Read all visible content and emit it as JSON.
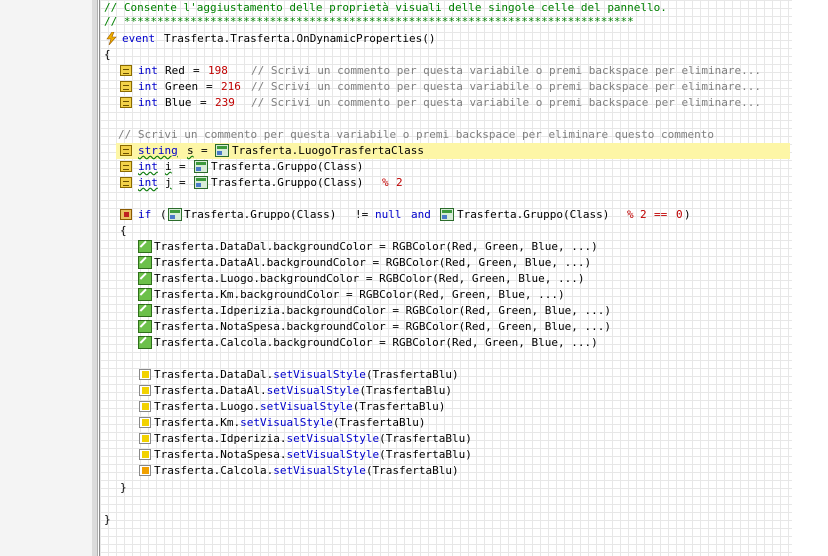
{
  "editor": {
    "comment_header": "// Consente l'aggiustamento delle proprietà visuali delle singole celle del pannello.",
    "comment_stars": "// *****************************************************************************",
    "event_kw": "event",
    "event_name": "Trasferta.Trasferta.OnDynamicProperties()",
    "brace_open": "{",
    "brace_close": "}",
    "vars": [
      {
        "type": "int",
        "name": "Red",
        "value": "198",
        "comment": "// Scrivi un commento per questa variabile o premi backspace per eliminare..."
      },
      {
        "type": "int",
        "name": "Green",
        "value": "216",
        "comment": "// Scrivi un commento per questa variabile o premi backspace per eliminare..."
      },
      {
        "type": "int",
        "name": "Blue",
        "value": "239",
        "comment": "// Scrivi un commento per questa variabile o premi backspace per eliminare..."
      }
    ],
    "comment_block": "// Scrivi un commento per questa variabile o premi backspace per eliminare questo commento",
    "string_decl": {
      "type": "string",
      "name": "s",
      "value": "Trasferta.LuogoTrasfertaClass"
    },
    "int_i": {
      "type": "int",
      "name": "i",
      "value": "Trasferta.Gruppo(Class)"
    },
    "int_j": {
      "type": "int",
      "name": "j",
      "value": "Trasferta.Gruppo(Class)",
      "mod": "%",
      "mod_val": "2"
    },
    "if_stmt": {
      "kw": "if",
      "open": "(",
      "left": "Trasferta.Gruppo(Class)",
      "ne": "!=",
      "null": "null",
      "and": "and",
      "right": "Trasferta.Gruppo(Class)",
      "mod": "%",
      "two": "2",
      "eq": "==",
      "zero": "0",
      "close": ")"
    },
    "assignments": [
      "Trasferta.DataDal.backgroundColor = RGBColor(Red, Green, Blue, ...)",
      "Trasferta.DataAl.backgroundColor = RGBColor(Red, Green, Blue, ...)",
      "Trasferta.Luogo.backgroundColor = RGBColor(Red, Green, Blue, ...)",
      "Trasferta.Km.backgroundColor = RGBColor(Red, Green, Blue, ...)",
      "Trasferta.Idperizia.backgroundColor = RGBColor(Red, Green, Blue, ...)",
      "Trasferta.NotaSpesa.backgroundColor = RGBColor(Red, Green, Blue, ...)",
      "Trasferta.Calcola.backgroundColor = RGBColor(Red, Green, Blue, ...)"
    ],
    "calls": [
      {
        "obj": "Trasferta.DataDal.",
        "method": "setVisualStyle",
        "arg": "(TrasfertaBlu)"
      },
      {
        "obj": "Trasferta.DataAl.",
        "method": "setVisualStyle",
        "arg": "(TrasfertaBlu)"
      },
      {
        "obj": "Trasferta.Luogo.",
        "method": "setVisualStyle",
        "arg": "(TrasfertaBlu)"
      },
      {
        "obj": "Trasferta.Km.",
        "method": "setVisualStyle",
        "arg": "(TrasfertaBlu)"
      },
      {
        "obj": "Trasferta.Idperizia.",
        "method": "setVisualStyle",
        "arg": "(TrasfertaBlu)"
      },
      {
        "obj": "Trasferta.NotaSpesa.",
        "method": "setVisualStyle",
        "arg": "(TrasfertaBlu)"
      },
      {
        "obj": "Trasferta.Calcola.",
        "method": "setVisualStyle",
        "arg": "(TrasfertaBlu)"
      }
    ]
  },
  "colors": {
    "comment": "#008000",
    "keyword": "#0000cc",
    "number": "#c00000",
    "highlight": "#fdf6a6"
  },
  "icons": {
    "event": "lightning-bolt-icon",
    "variable": "variable-icon",
    "class": "class-icon",
    "if": "if-statement-icon",
    "assign": "assignment-icon",
    "call": "method-call-icon"
  }
}
